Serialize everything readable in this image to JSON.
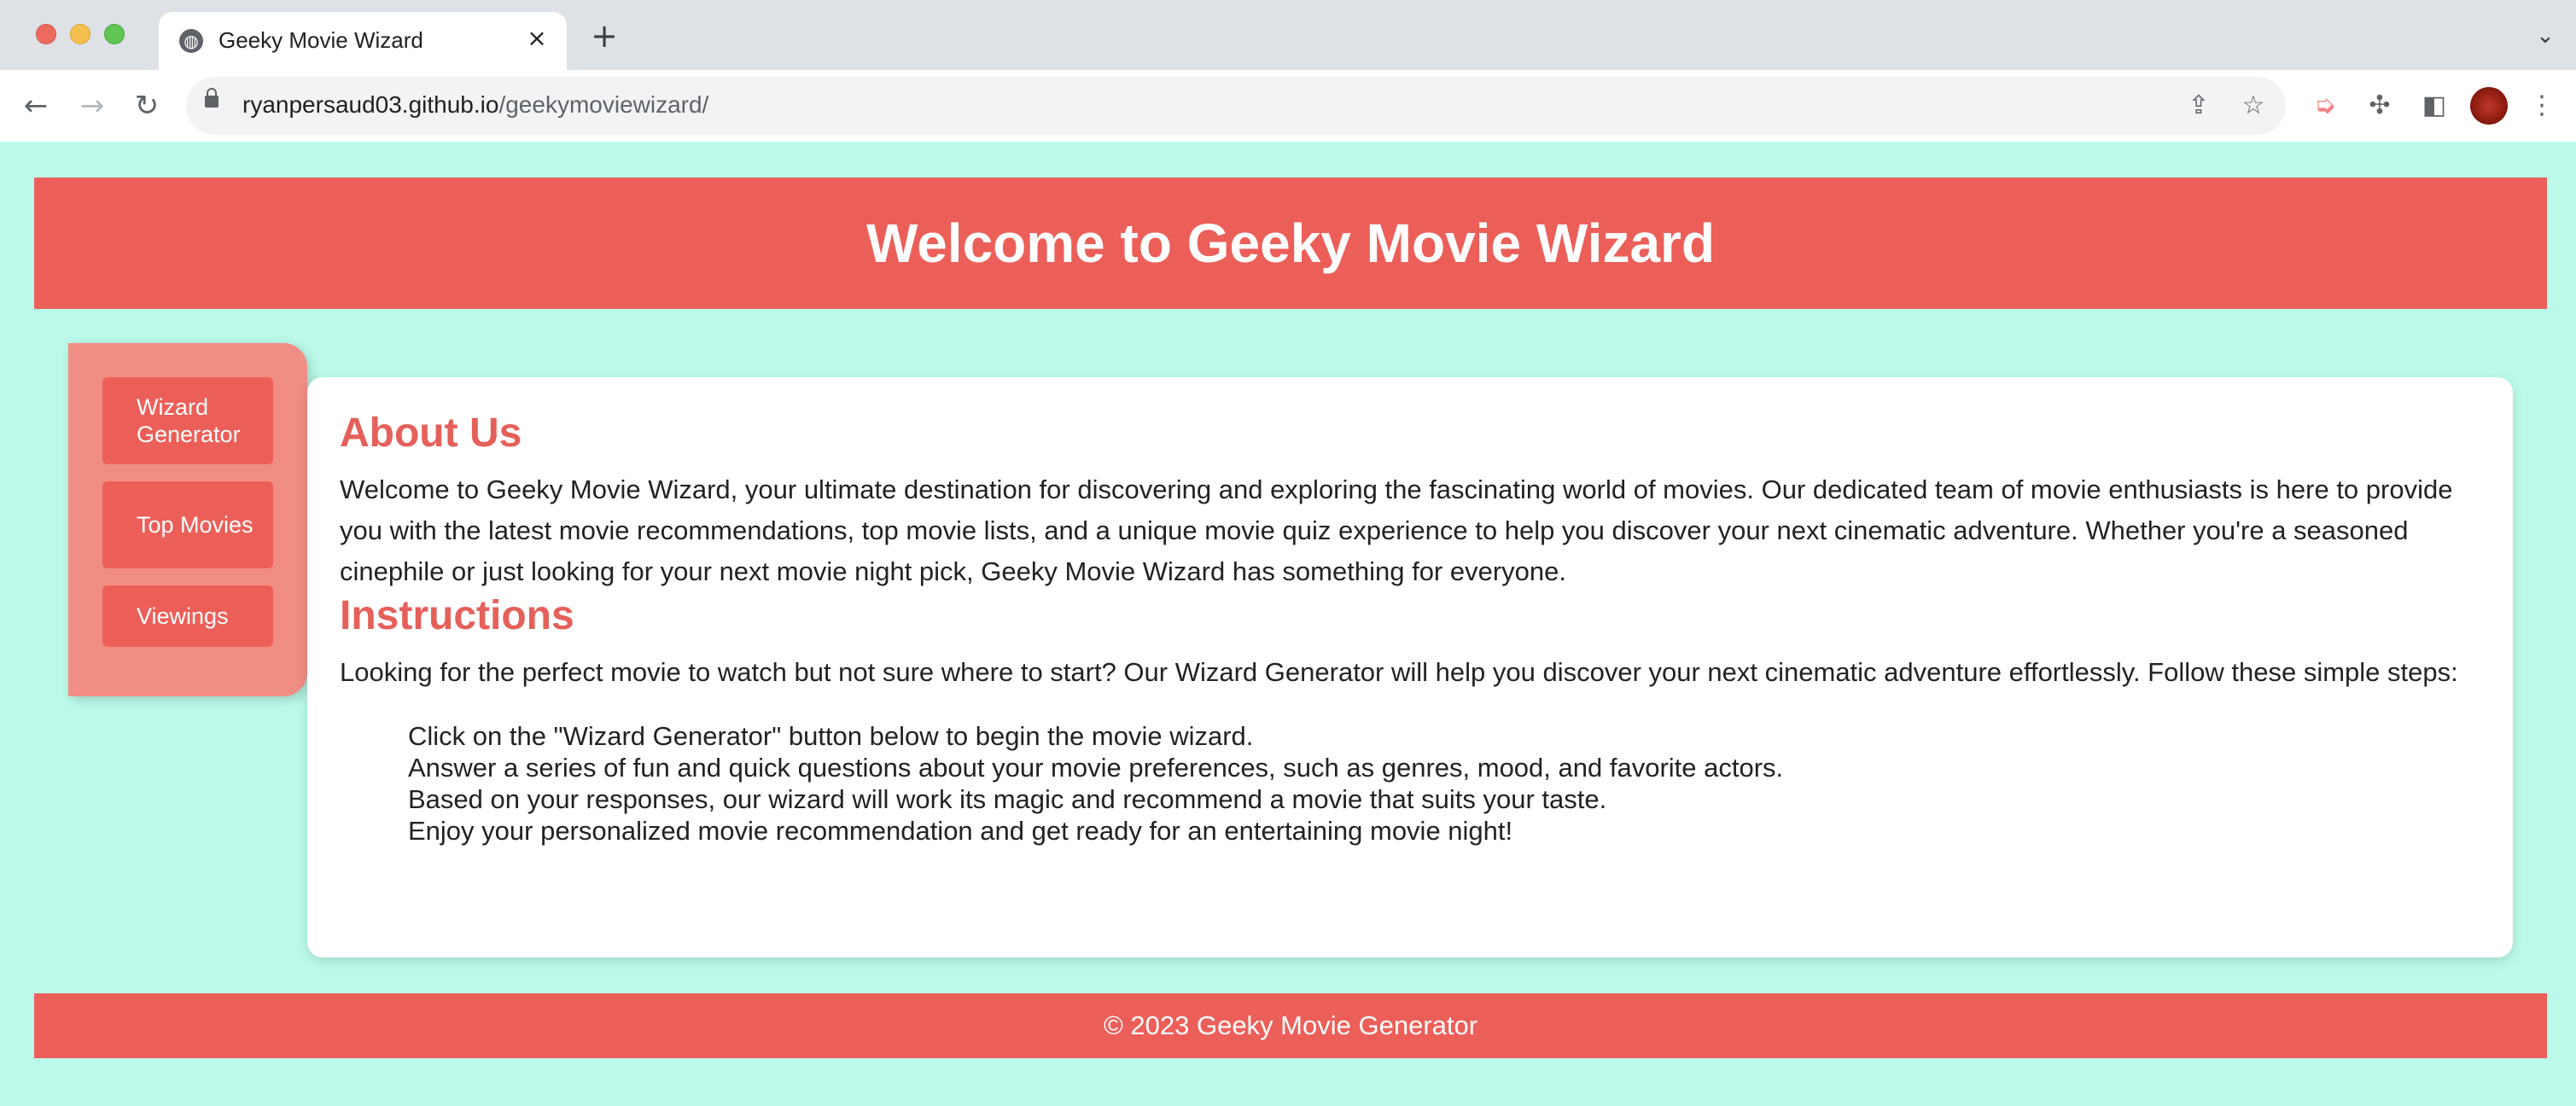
{
  "browser": {
    "tab_title": "Geeky Movie Wizard",
    "url_host": "ryanpersaud03.github.io",
    "url_path": "/geekymoviewizard/",
    "icons": {
      "favicon": "globe-icon",
      "close": "close-icon",
      "new_tab": "plus-icon",
      "back": "arrow-left-icon",
      "forward": "arrow-right-icon",
      "reload": "reload-icon",
      "share": "share-icon",
      "bookmark": "star-icon",
      "extension": "extension-icon",
      "puzzle": "puzzle-icon",
      "side_panel": "side-panel-icon",
      "menu": "kebab-menu-icon"
    }
  },
  "header": {
    "title": "Welcome to Geeky Movie Wizard"
  },
  "sidebar": {
    "items": [
      {
        "label": "Wizard Generator"
      },
      {
        "label": "Top Movies"
      },
      {
        "label": "Viewings"
      }
    ]
  },
  "main": {
    "about_heading": "About Us",
    "about_text": "Welcome to Geeky Movie Wizard, your ultimate destination for discovering and exploring the fascinating world of movies. Our dedicated team of movie enthusiasts is here to provide you with the latest movie recommendations, top movie lists, and a unique movie quiz experience to help you discover your next cinematic adventure. Whether you're a seasoned cinephile or just looking for your next movie night pick, Geeky Movie Wizard has something for everyone.",
    "instructions_heading": "Instructions",
    "instructions_text": "Looking for the perfect movie to watch but not sure where to start? Our Wizard Generator will help you discover your next cinematic adventure effortlessly. Follow these simple steps:",
    "steps": [
      "Click on the \"Wizard Generator\" button below to begin the movie wizard.",
      "Answer a series of fun and quick questions about your movie preferences, such as genres, mood, and favorite actors.",
      "Based on your responses, our wizard will work its magic and recommend a movie that suits your taste.",
      "Enjoy your personalized movie recommendation and get ready for an entertaining movie night!"
    ]
  },
  "footer": {
    "text": "© 2023 Geeky Movie Generator"
  },
  "colors": {
    "page_background": "#bbfaea",
    "accent": "#ec5f59",
    "sidebar_background": "#f08e84",
    "heading": "#e5605a"
  }
}
